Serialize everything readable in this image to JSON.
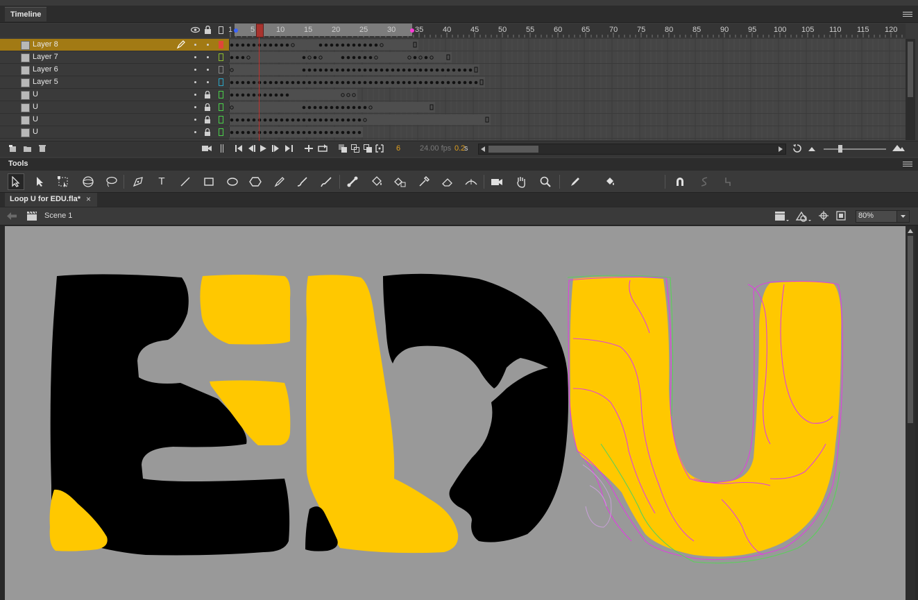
{
  "timeline": {
    "title": "Timeline",
    "ruler_numbers": [
      "1",
      "5",
      "10",
      "15",
      "20",
      "25",
      "30",
      "35",
      "40",
      "45",
      "50",
      "55",
      "60",
      "65",
      "70",
      "75",
      "80",
      "85",
      "90",
      "95",
      "100",
      "105",
      "110",
      "115",
      "120"
    ],
    "current_frame": "6",
    "fps": "24.00 fps",
    "elapsed": "0.2",
    "elapsed_unit": "s",
    "layers": [
      {
        "name": "Layer 8",
        "selected": true,
        "locked": false,
        "outline_color": "#e0463a"
      },
      {
        "name": "Layer 7",
        "selected": false,
        "locked": false,
        "outline_color": "#8fbf2f"
      },
      {
        "name": "Layer 6",
        "selected": false,
        "locked": false,
        "outline_color": "#8a8a8a"
      },
      {
        "name": "Layer 5",
        "selected": false,
        "locked": false,
        "outline_color": "#2aa7c8"
      },
      {
        "name": "U",
        "selected": false,
        "locked": true,
        "outline_color": "#4ad24a"
      },
      {
        "name": "U",
        "selected": false,
        "locked": true,
        "outline_color": "#4ad24a"
      },
      {
        "name": "U",
        "selected": false,
        "locked": true,
        "outline_color": "#4ad24a"
      },
      {
        "name": "U",
        "selected": false,
        "locked": true,
        "outline_color": "#4ad24a"
      }
    ]
  },
  "tools": {
    "title": "Tools",
    "items": [
      "selection-tool",
      "subselection-tool",
      "free-transform-tool",
      "3d-rotation-tool",
      "lasso-tool",
      "pen-tool",
      "text-tool",
      "line-tool",
      "rectangle-tool",
      "oval-tool",
      "polystar-tool",
      "pencil-tool",
      "paint-brush-tool",
      "brush-tool",
      "bone-tool",
      "paint-bucket-tool",
      "ink-bottle-tool",
      "eyedropper-tool",
      "eraser-tool",
      "width-tool",
      "camera-tool",
      "hand-tool",
      "zoom-tool"
    ],
    "text_tool_glyph": "T"
  },
  "document": {
    "tab_title": "Loop U for EDU.fla*",
    "close_glyph": "×",
    "scene_name": "Scene 1",
    "zoom": "80%"
  },
  "colors": {
    "accent_selected_layer": "#a27a14",
    "playhead": "#c0302c",
    "stage": "#999999",
    "fill_yellow": "#ffc800",
    "fill_black": "#000000",
    "onion_magenta": "#e040e0",
    "onion_green": "#5ad05a"
  }
}
